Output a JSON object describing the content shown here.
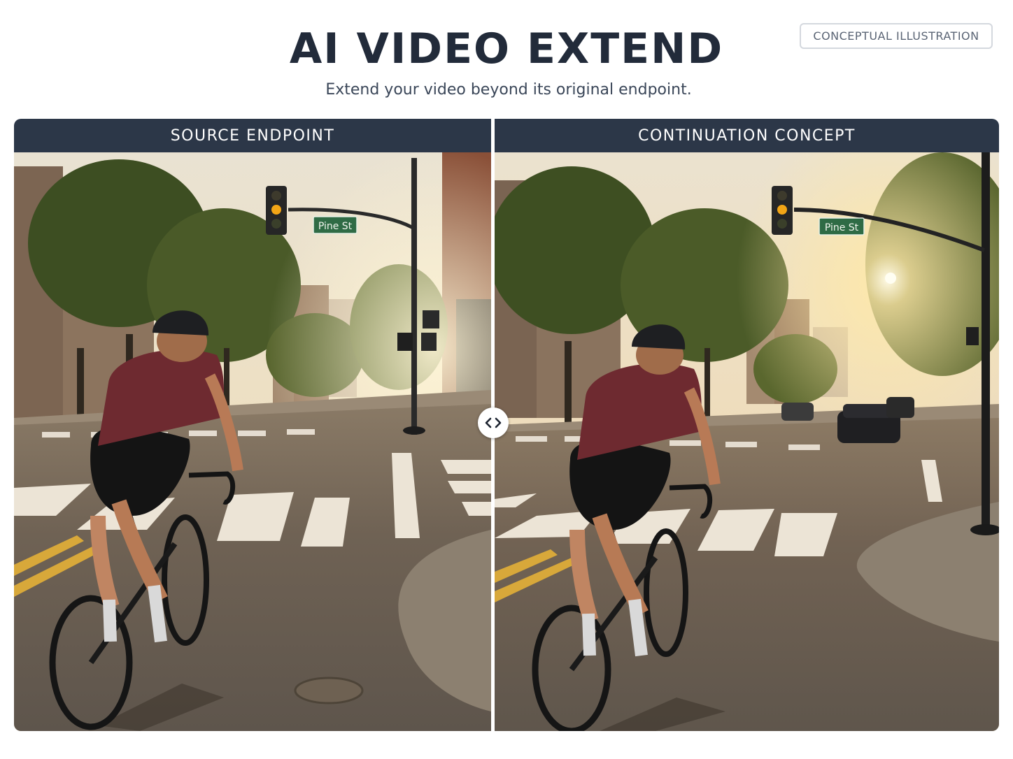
{
  "header": {
    "title": "AI VIDEO EXTEND",
    "subtitle": "Extend your video beyond its original endpoint.",
    "badge": "CONCEPTUAL ILLUSTRATION"
  },
  "comparison": {
    "left_panel": {
      "label": "SOURCE ENDPOINT",
      "street_sign": "Pine St"
    },
    "right_panel": {
      "label": "CONTINUATION CONCEPT",
      "street_sign": "Pine St"
    },
    "handle_icon": "chevrons-left-right-icon"
  },
  "colors": {
    "title": "#222b3a",
    "panel_header": "#2c3748",
    "sign_green": "#2f6b45",
    "jersey": "#6e2a30"
  }
}
